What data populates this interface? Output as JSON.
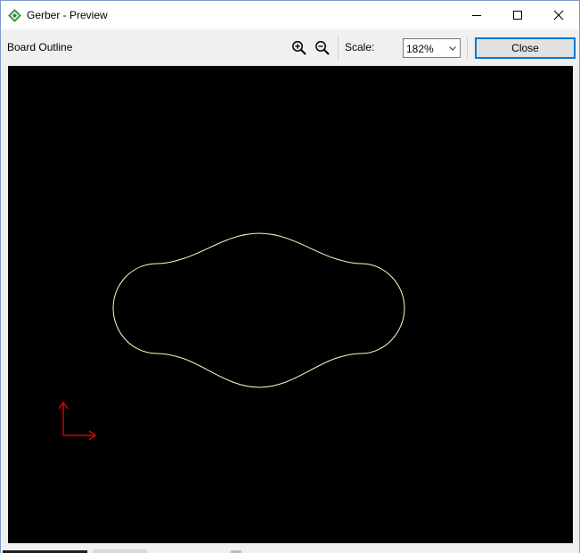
{
  "window": {
    "title": "Gerber - Preview"
  },
  "toolbar": {
    "panel_label": "Board Outline",
    "zoom_in_icon": "zoom-in-icon",
    "zoom_out_icon": "zoom-out-icon",
    "scale_label": "Scale:",
    "scale_value": "182%",
    "close_label": "Close"
  },
  "preview": {
    "background": "#000000",
    "outline_color": "#ffffc0",
    "origin_marker_color": "#ff0000",
    "outline_shape": "rounded-board-outline",
    "origin_icon": "origin-axes-icon"
  },
  "colors": {
    "accent": "#0078d7",
    "app_icon": "#3aa04a"
  }
}
